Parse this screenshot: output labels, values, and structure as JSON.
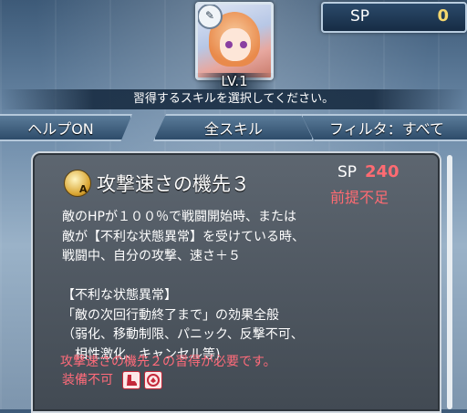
{
  "header": {
    "sp_label": "SP",
    "sp_value": "0",
    "level": "LV.1",
    "instruction": "習得するスキルを選択してください。"
  },
  "tabs": [
    {
      "label": "ヘルプON"
    },
    {
      "label": "全スキル"
    },
    {
      "label": "フィルタ：すべて"
    }
  ],
  "skill": {
    "icon": "speed-strike-a-icon",
    "icon_letter": "A",
    "name": "攻撃速さの機先３",
    "sp_label": "SP",
    "sp_cost": "240",
    "status": "前提不足",
    "description": [
      "敵のHPが１００％で戦闘開始時、または",
      "敵が【不利な状態異常】を受けている時、",
      "戦闘中、自分の攻撃、速さ＋５",
      "",
      "【不利な状態異常】",
      "「敵の次回行動終了まで」の効果全般",
      "（弱化、移動制限、パニック、反撃不可、",
      "　相性激化、キャンセル等)"
    ],
    "requirement": "攻撃速さの機先２の習得が必要です。",
    "unequippable": "装備不可",
    "restriction_icons": [
      "infantry-boot-icon",
      "dragon-icon"
    ]
  },
  "colors": {
    "warning": "#ff6b72",
    "sp_value": "#f5d76e"
  }
}
